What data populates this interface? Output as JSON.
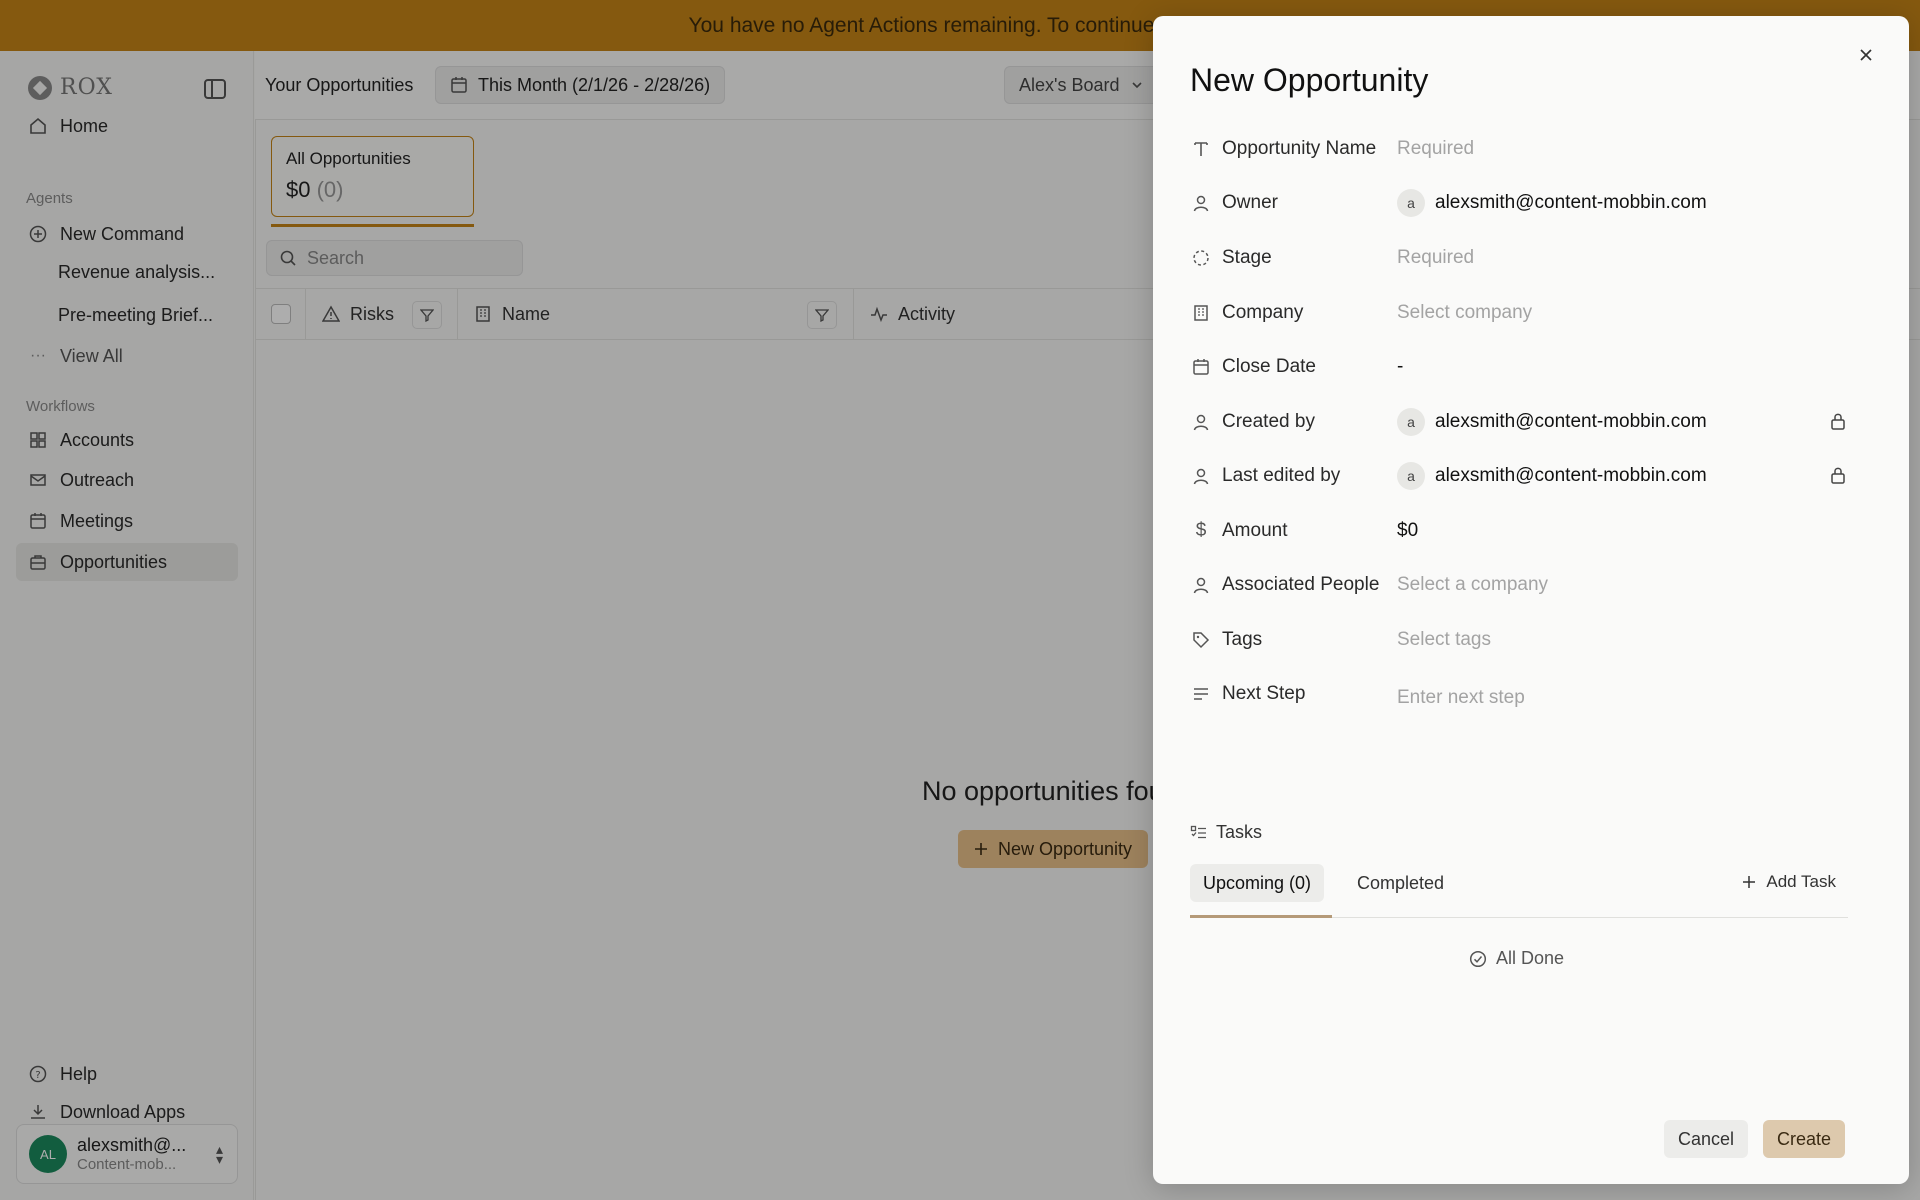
{
  "banner": {
    "text": "You have no Agent Actions remaining. To continue using R"
  },
  "sidebar": {
    "logo_text": "ROX",
    "home": "Home",
    "agents_section": "Agents",
    "new_command": "New Command",
    "sub_items": [
      "Revenue analysis...",
      "Pre-meeting Brief..."
    ],
    "view_all": "View All",
    "workflows_section": "Workflows",
    "workflows": [
      "Accounts",
      "Outreach",
      "Meetings",
      "Opportunities"
    ],
    "help": "Help",
    "download_apps": "Download Apps",
    "user": {
      "initials": "AL",
      "name": "alexsmith@...",
      "org": "Content-mob..."
    }
  },
  "main": {
    "title": "Your Opportunities",
    "date_range": "This Month (2/1/26 - 2/28/26)",
    "board": "Alex's Board",
    "card": {
      "title": "All Opportunities",
      "value": "$0",
      "count": "(0)"
    },
    "search_placeholder": "Search",
    "columns": [
      "Risks",
      "Name",
      "Activity"
    ],
    "empty_title": "No opportunities fou",
    "empty_button": "New Opportunity"
  },
  "drawer": {
    "title": "New Opportunity",
    "fields": [
      {
        "label": "Opportunity Name",
        "value": "Required",
        "placeholder": true
      },
      {
        "label": "Owner",
        "value": "alexsmith@content-mobbin.com",
        "avatar": "a"
      },
      {
        "label": "Stage",
        "value": "Required",
        "placeholder": true
      },
      {
        "label": "Company",
        "value": "Select company",
        "placeholder": true
      },
      {
        "label": "Close Date",
        "value": "-"
      },
      {
        "label": "Created by",
        "value": "alexsmith@content-mobbin.com",
        "avatar": "a"
      },
      {
        "label": "Last edited by",
        "value": "alexsmith@content-mobbin.com",
        "avatar": "a"
      },
      {
        "label": "Amount",
        "value": "$0"
      },
      {
        "label": "Associated People",
        "value": "Select a company",
        "placeholder": true
      },
      {
        "label": "Tags",
        "value": "Select tags",
        "placeholder": true
      },
      {
        "label": "Next Step",
        "value": "Enter next step",
        "placeholder": true
      }
    ],
    "tasks": {
      "heading": "Tasks",
      "tab_upcoming": "Upcoming (0)",
      "tab_completed": "Completed",
      "add_task": "Add Task",
      "all_done": "All Done"
    },
    "cancel": "Cancel",
    "create": "Create"
  }
}
